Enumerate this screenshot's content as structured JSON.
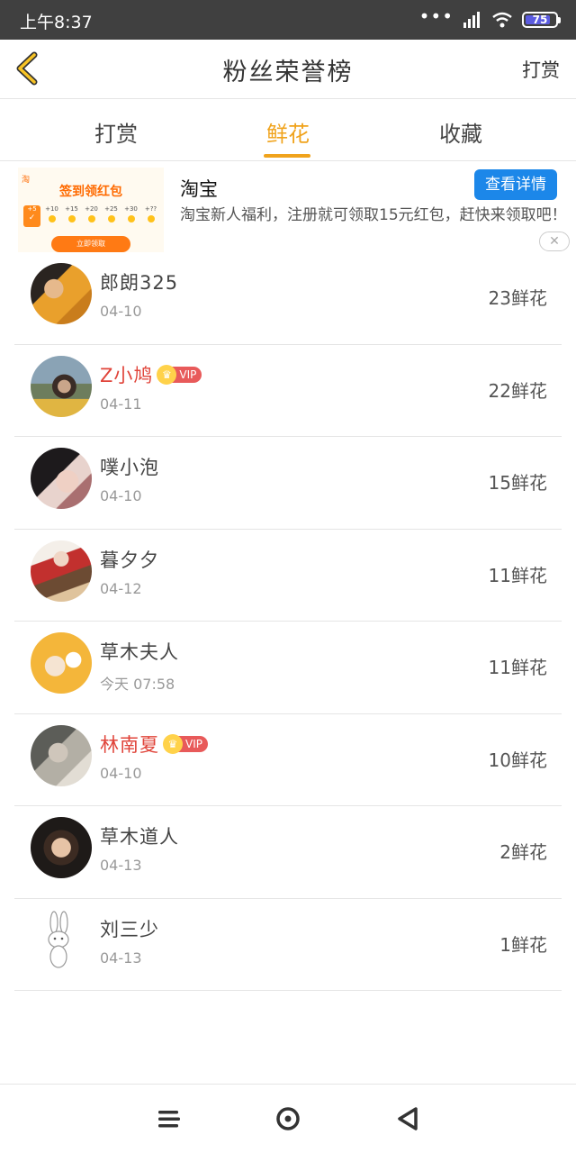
{
  "status_bar": {
    "time": "上午8:37",
    "signal_dots": "•••",
    "battery_level": "75"
  },
  "header": {
    "back_icon": "chevron-left-icon",
    "title": "粉丝荣誉榜",
    "right_action": "打赏"
  },
  "tabs": [
    {
      "label": "打赏",
      "active": false
    },
    {
      "label": "鲜花",
      "active": true
    },
    {
      "label": "收藏",
      "active": false
    }
  ],
  "ad": {
    "image": {
      "logo": "淘",
      "title": "签到领红包",
      "days": [
        "+5",
        "+10",
        "+15",
        "+20",
        "+25",
        "+30",
        "+??"
      ],
      "claim_label": "立即领取"
    },
    "brand": "淘宝",
    "description": "淘宝新人福利，注册就可领取15元红包，赶快来领取吧！",
    "detail_button": "查看详情",
    "close_icon": "close-icon"
  },
  "fans": [
    {
      "name": "郎朗325",
      "date": "04-10",
      "count": "23鲜花",
      "vip": false
    },
    {
      "name": "Z小鸠",
      "date": "04-11",
      "count": "22鲜花",
      "vip": true,
      "vip_label": "VIP"
    },
    {
      "name": "噗小泡",
      "date": "04-10",
      "count": "15鲜花",
      "vip": false
    },
    {
      "name": "暮夕夕",
      "date": "04-12",
      "count": "11鲜花",
      "vip": false
    },
    {
      "name": "草木夫人",
      "date": "今天 07:58",
      "count": "11鲜花",
      "vip": false
    },
    {
      "name": "林南夏",
      "date": "04-10",
      "count": "10鲜花",
      "vip": true,
      "vip_label": "VIP"
    },
    {
      "name": "草木道人",
      "date": "04-13",
      "count": "2鲜花",
      "vip": false
    },
    {
      "name": "刘三少",
      "date": "04-13",
      "count": "1鲜花",
      "vip": false
    }
  ],
  "nav": {
    "menu_icon": "menu-icon",
    "home_icon": "home-circle-icon",
    "back_icon": "back-triangle-icon"
  },
  "colors": {
    "accent": "#f0a31c",
    "vip_name": "#e0443a",
    "ad_button": "#1c87e9"
  }
}
